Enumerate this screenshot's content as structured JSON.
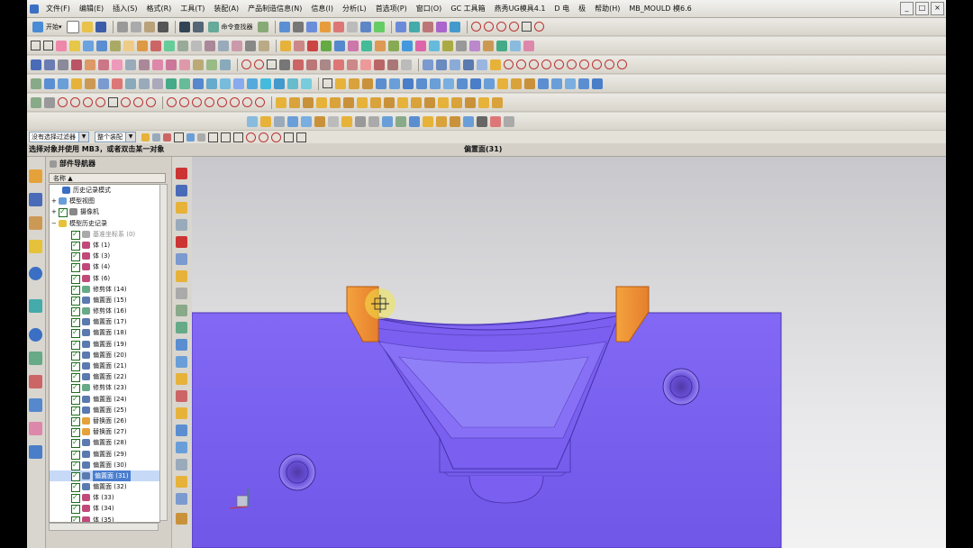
{
  "menu": [
    "文件(F)",
    "编辑(E)",
    "插入(S)",
    "格式(R)",
    "工具(T)",
    "装配(A)",
    "产品制造信息(N)",
    "信息(I)",
    "分析(L)",
    "首选项(P)",
    "窗口(O)",
    "GC 工具箱",
    "燕秀UG模具4.1",
    "D 电",
    "极",
    "帮助(H)",
    "MB_MOULD 模6.6"
  ],
  "toolbar": {
    "start_label": "开始▾",
    "command_finder_label": "命令查找器"
  },
  "selection": {
    "filter": "没有选择过滤器",
    "assembly": "整个装配"
  },
  "status": {
    "prompt": "选择对象并使用 MB3，或者双击某一对象",
    "center": "偏置面(31)"
  },
  "navigator": {
    "title": "部件导航器",
    "column_header": "名称 ▲",
    "rows": [
      {
        "text": "历史记录模式",
        "indent": 1,
        "check": false,
        "icon": "clock",
        "grey": false
      },
      {
        "text": "模型视图",
        "indent": 0,
        "check": false,
        "icon": "views",
        "grey": false,
        "expander": "+"
      },
      {
        "text": "摄像机",
        "indent": 0,
        "check": true,
        "icon": "camera",
        "grey": false,
        "expander": "+"
      },
      {
        "text": "模型历史记录",
        "indent": 0,
        "check": false,
        "icon": "folder",
        "grey": false,
        "expander": "−"
      },
      {
        "text": "基准坐标系 (0)",
        "indent": 2,
        "check": true,
        "icon": "csys",
        "grey": true
      },
      {
        "text": "体 (1)",
        "indent": 2,
        "check": true,
        "icon": "body",
        "grey": false
      },
      {
        "text": "体 (3)",
        "indent": 2,
        "check": true,
        "icon": "body",
        "grey": false
      },
      {
        "text": "体 (4)",
        "indent": 2,
        "check": true,
        "icon": "body",
        "grey": false
      },
      {
        "text": "体 (6)",
        "indent": 2,
        "check": true,
        "icon": "body",
        "grey": false
      },
      {
        "text": "修剪体 (14)",
        "indent": 2,
        "check": true,
        "icon": "trim",
        "grey": false
      },
      {
        "text": "偏置面 (15)",
        "indent": 2,
        "check": true,
        "icon": "offset",
        "grey": false
      },
      {
        "text": "修剪体 (16)",
        "indent": 2,
        "check": true,
        "icon": "trim",
        "grey": false
      },
      {
        "text": "偏置面 (17)",
        "indent": 2,
        "check": true,
        "icon": "offset",
        "grey": false
      },
      {
        "text": "偏置面 (18)",
        "indent": 2,
        "check": true,
        "icon": "offset",
        "grey": false
      },
      {
        "text": "偏置面 (19)",
        "indent": 2,
        "check": true,
        "icon": "offset",
        "grey": false
      },
      {
        "text": "偏置面 (20)",
        "indent": 2,
        "check": true,
        "icon": "offset",
        "grey": false
      },
      {
        "text": "偏置面 (21)",
        "indent": 2,
        "check": true,
        "icon": "offset",
        "grey": false
      },
      {
        "text": "偏置面 (22)",
        "indent": 2,
        "check": true,
        "icon": "offset",
        "grey": false
      },
      {
        "text": "修剪体 (23)",
        "indent": 2,
        "check": true,
        "icon": "trim",
        "grey": false
      },
      {
        "text": "偏置面 (24)",
        "indent": 2,
        "check": true,
        "icon": "offset",
        "grey": false
      },
      {
        "text": "偏置面 (25)",
        "indent": 2,
        "check": true,
        "icon": "offset",
        "grey": false
      },
      {
        "text": "替换面 (26)",
        "indent": 2,
        "check": true,
        "icon": "replace",
        "grey": false
      },
      {
        "text": "替换面 (27)",
        "indent": 2,
        "check": true,
        "icon": "replace",
        "grey": false
      },
      {
        "text": "偏置面 (28)",
        "indent": 2,
        "check": true,
        "icon": "offset",
        "grey": false
      },
      {
        "text": "偏置面 (29)",
        "indent": 2,
        "check": true,
        "icon": "offset",
        "grey": false
      },
      {
        "text": "偏置面 (30)",
        "indent": 2,
        "check": true,
        "icon": "offset",
        "grey": false
      },
      {
        "text": "偏置面 (31)",
        "indent": 2,
        "check": true,
        "icon": "offset",
        "grey": false,
        "selected": true
      },
      {
        "text": "偏置面 (32)",
        "indent": 2,
        "check": true,
        "icon": "offset",
        "grey": false
      },
      {
        "text": "体 (33)",
        "indent": 2,
        "check": true,
        "icon": "body",
        "grey": false
      },
      {
        "text": "体 (34)",
        "indent": 2,
        "check": true,
        "icon": "body",
        "grey": false
      },
      {
        "text": "体 (35)",
        "indent": 2,
        "check": true,
        "icon": "body",
        "grey": false
      }
    ]
  },
  "colors": {
    "part": "#7d60f2",
    "part_edge": "#4c36b0",
    "highlight": "#f2973a"
  }
}
